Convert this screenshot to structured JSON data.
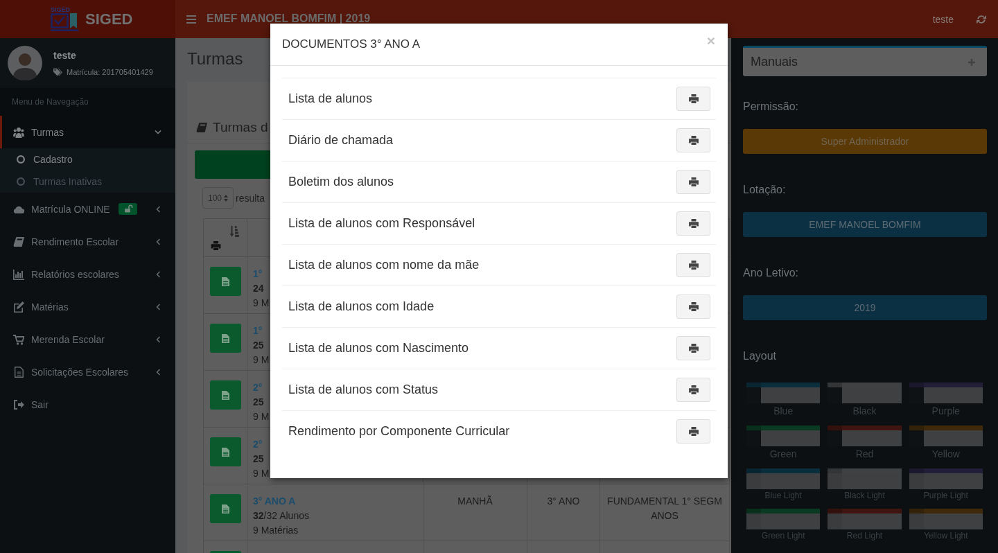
{
  "header": {
    "logo_mark": "SIGED",
    "app_name": "SIGED",
    "school": "EMEF MANOEL BOMFIM | 2019",
    "user": "teste"
  },
  "sidebar": {
    "user": {
      "name": "teste",
      "registration": "Matrícula: 201705401429"
    },
    "menu_title": "Menu de Navegação",
    "items": [
      {
        "kind": "tree",
        "label": "Turmas",
        "selected": true,
        "expanded": true,
        "badge": false,
        "children": [
          {
            "label": "Cadastro",
            "selected": true
          },
          {
            "label": "Turmas Inativas",
            "selected": false
          }
        ]
      },
      {
        "kind": "tree",
        "label": "Matrícula ONLINE",
        "selected": false,
        "expanded": false,
        "badge": true
      },
      {
        "kind": "tree",
        "label": "Rendimento Escolar",
        "selected": false,
        "expanded": false,
        "badge": false
      },
      {
        "kind": "tree",
        "label": "Relatórios escolares",
        "selected": false,
        "expanded": false,
        "badge": false
      },
      {
        "kind": "tree",
        "label": "Matérias",
        "selected": false,
        "expanded": false,
        "badge": false
      },
      {
        "kind": "tree",
        "label": "Merenda Escolar",
        "selected": false,
        "expanded": false,
        "badge": false
      },
      {
        "kind": "tree",
        "label": "Solicitações Escolares",
        "selected": false,
        "expanded": false,
        "badge": false
      },
      {
        "kind": "link",
        "label": "Sair",
        "selected": false
      }
    ]
  },
  "content": {
    "title": "Turmas",
    "box_title": "Turmas d",
    "page_size": "100",
    "page_size_label": "resulta",
    "table": {
      "rows": [
        {
          "name": "1°",
          "students": "**24**",
          "subjects": "9 M"
        },
        {
          "name": "1°",
          "students": "**25**",
          "subjects": "9 M"
        },
        {
          "name": "2°",
          "students": "**25**",
          "subjects": "9 M"
        },
        {
          "name": "2°",
          "students": "**25**",
          "subjects": "9 M"
        },
        {
          "name": "3° ANO A",
          "students": "**32**/32 Alunos",
          "subjects": "9 Matérias",
          "shift": "MANHÃ",
          "grade": "3° ANO",
          "stage": "FUNDAMENTAL 1° SEGM ANOS"
        },
        {}
      ]
    }
  },
  "control_sidebar": {
    "manuals": {
      "title": "Manuais",
      "expanded": false
    },
    "sections": [
      {
        "label": "Permissão:",
        "value": "Super Administrador",
        "kind": "warning"
      },
      {
        "label": "Lotação:",
        "value": "EMEF MANOEL BOMFIM",
        "kind": "primary"
      },
      {
        "label": "Ano Letivo:",
        "value": "2019",
        "kind": "primary"
      }
    ],
    "layout": {
      "title": "Layout",
      "skins": [
        {
          "label": "Blue",
          "color": "#0b2e3d",
          "light": false
        },
        {
          "label": "Black",
          "color": "#404142",
          "light": false
        },
        {
          "label": "Purple",
          "color": "#221e38",
          "light": false
        },
        {
          "label": "Green",
          "color": "#0b3a23",
          "light": false
        },
        {
          "label": "Red",
          "color": "#3e1511",
          "light": false
        },
        {
          "label": "Yellow",
          "color": "#3e2a0b",
          "light": false
        },
        {
          "label": "Blue Light",
          "color": "#0b2e3d",
          "light": true
        },
        {
          "label": "Black Light",
          "color": "#404142",
          "light": true
        },
        {
          "label": "Purple Light",
          "color": "#221e38",
          "light": true
        },
        {
          "label": "Green Light",
          "color": "#0b3a23",
          "light": true
        },
        {
          "label": "Red Light",
          "color": "#3e1511",
          "light": true
        },
        {
          "label": "Yellow Light",
          "color": "#3e2a0b",
          "light": true
        }
      ]
    }
  },
  "modal": {
    "title": "DOCUMENTOS 3° ANO A",
    "close": "×",
    "documents": [
      "Lista de alunos",
      "Diário de chamada",
      "Boletim dos alunos",
      "Lista de alunos com Responsável",
      "Lista de alunos com nome da mãe",
      "Lista de alunos com Idade",
      "Lista de alunos com Nascimento",
      "Lista de alunos com Status",
      "Rendimento por Componente Curricular"
    ]
  }
}
